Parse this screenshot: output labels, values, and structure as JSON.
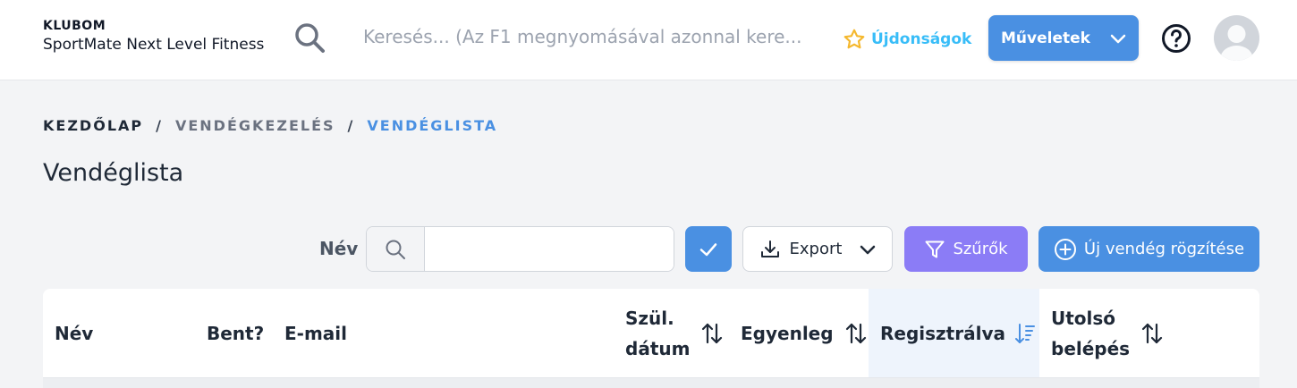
{
  "header": {
    "club_label": "KLUBOM",
    "club_name": "SportMate Next Level Fitness",
    "search_placeholder": "Keresés... (Az F1 megnyomásával azonnal kere...",
    "news_label": "Újdonságok",
    "actions_label": "Műveletek",
    "icons": {
      "search": "search-icon",
      "news": "star-icon",
      "actions": "chevron-down-icon",
      "help": "help-icon",
      "avatar": "avatar"
    }
  },
  "breadcrumb": {
    "items": [
      "KEZDŐLAP",
      "VENDÉGKEZELÉS",
      "VENDÉGLISTA"
    ],
    "separator": "/"
  },
  "page": {
    "title": "Vendéglista"
  },
  "toolbar": {
    "name_label": "Név",
    "name_value": "",
    "export_label": "Export",
    "filters_label": "Szűrők",
    "new_guest_label": "Új vendég rögzítése"
  },
  "table": {
    "columns": [
      {
        "label": "Név",
        "sortable": false
      },
      {
        "label": "Bent?",
        "sortable": false
      },
      {
        "label": "E-mail",
        "sortable": false
      },
      {
        "label_line1": "Szül.",
        "label_line2": "dátum",
        "sortable": true
      },
      {
        "label": "Egyenleg",
        "sortable": true
      },
      {
        "label": "Regisztrálva",
        "sortable": true,
        "sorted": "desc"
      },
      {
        "label_line1": "Utolsó",
        "label_line2": "belépés",
        "sortable": true
      }
    ]
  },
  "colors": {
    "primary": "#4a90e2",
    "filter": "#8b7cf6",
    "news": "#38bdf8",
    "star": "#f5b82e",
    "sorted_column_bg": "#eef4fc"
  }
}
